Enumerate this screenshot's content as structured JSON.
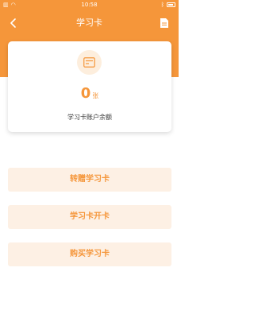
{
  "status_bar": {
    "time": "10:58",
    "left_icons": [
      "sim-icon",
      "wifi-icon"
    ],
    "right_icons": [
      "bluetooth-icon",
      "battery-icon"
    ]
  },
  "header": {
    "title": "学习卡",
    "back_icon": "chevron-left-icon",
    "action_icon": "document-icon"
  },
  "balance_card": {
    "icon": "card-icon",
    "value": "0",
    "unit": "张",
    "label": "学习卡账户余额"
  },
  "actions": {
    "transfer": "转赠学习卡",
    "activate": "学习卡开卡",
    "buy": "购买学习卡"
  },
  "colors": {
    "accent": "#f5963a",
    "button_bg": "#fdf0e4",
    "icon_circle_bg": "#fdeedd"
  }
}
